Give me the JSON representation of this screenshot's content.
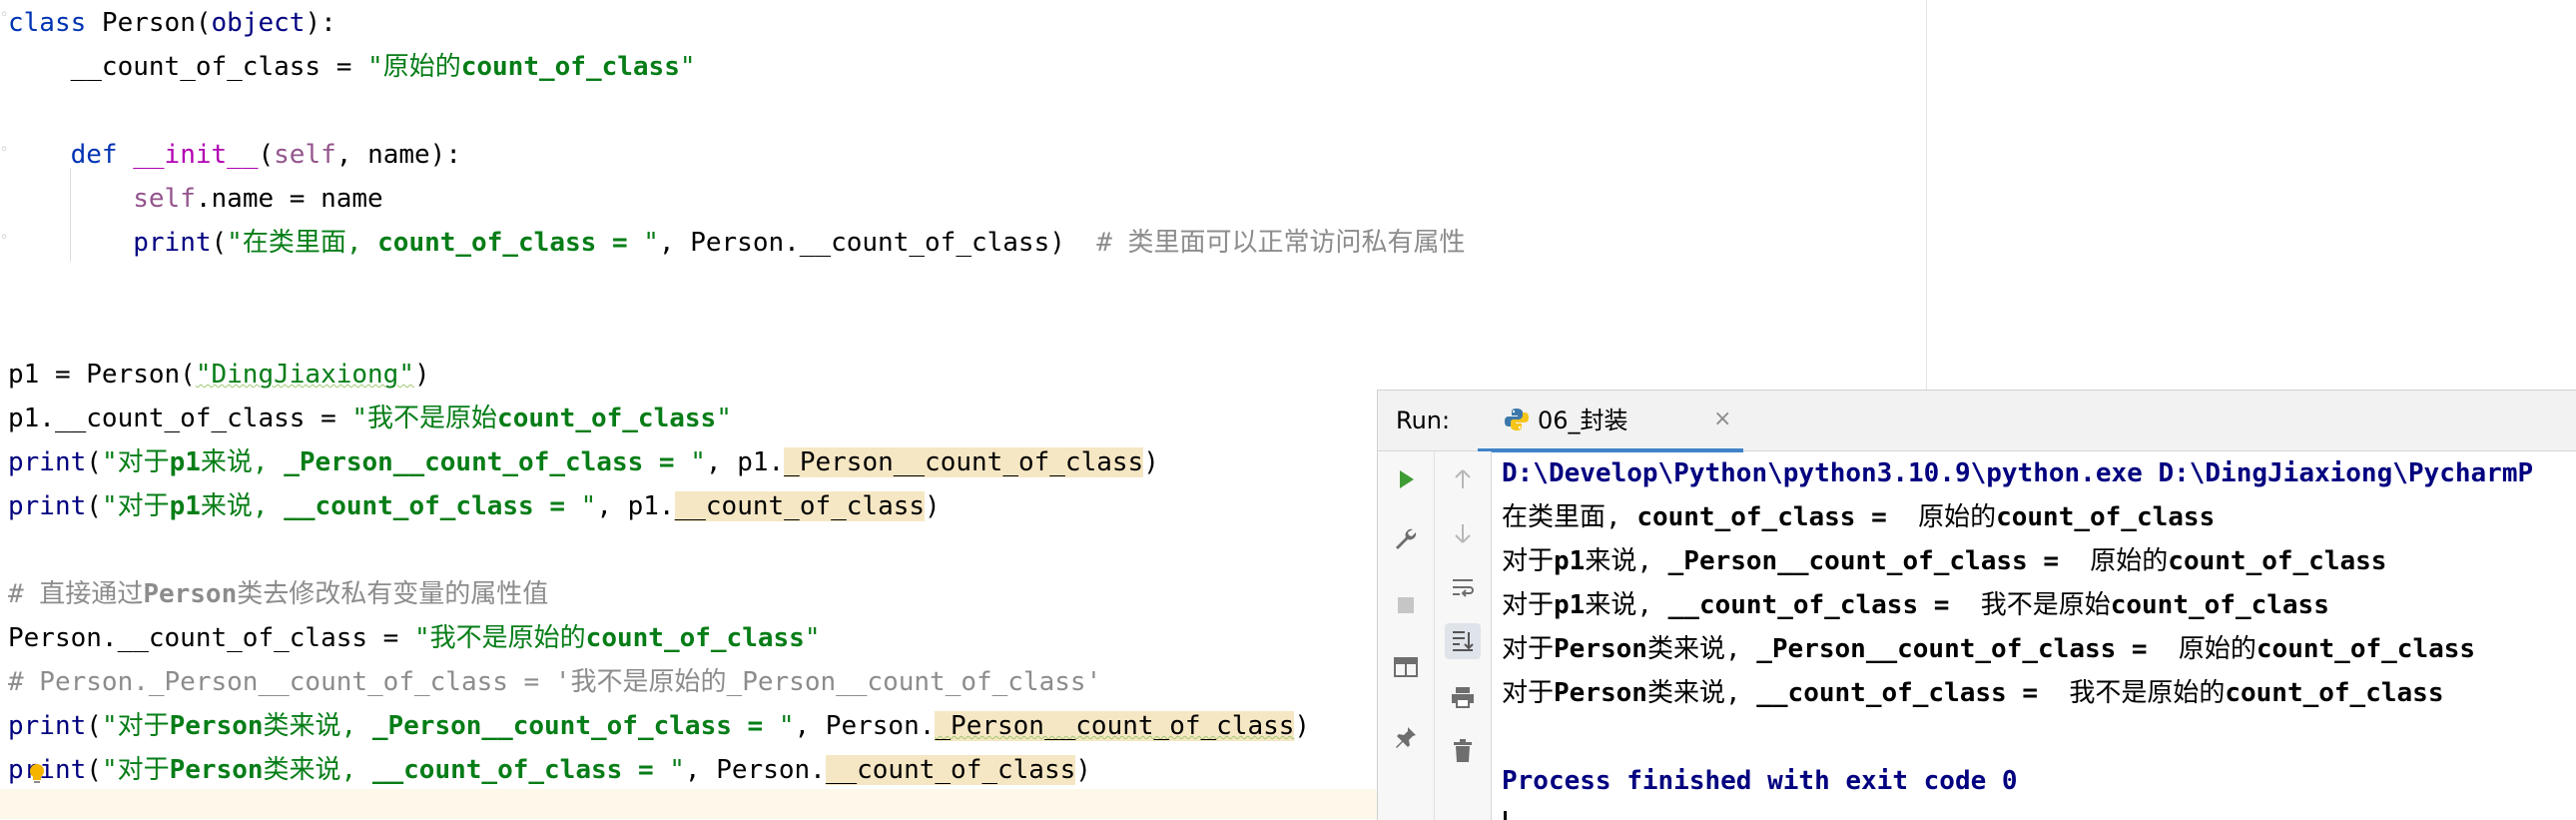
{
  "editor": {
    "lines": {
      "l1": {
        "kw": "class",
        "name": " Person",
        "open": "(",
        "base": "object",
        "close": "):"
      },
      "l2": {
        "indent": "    ",
        "attr": "__count_of_class",
        "eq": " = ",
        "str_open": "\"",
        "str_cn": "原始的",
        "str_en": "count_of_class",
        "str_close": "\""
      },
      "l4": {
        "indent": "    ",
        "kw": "def",
        "sp": " ",
        "fn": "__init__",
        "open": "(",
        "self": "self",
        "rest": ", name):"
      },
      "l5": {
        "indent": "        ",
        "self": "self",
        "rest": ".name = name"
      },
      "l6": {
        "indent": "        ",
        "fn": "print",
        "open": "(",
        "str_open": "\"",
        "str_cn": "在类里面, ",
        "str_en": "count_of_class = ",
        "str_close": "\"",
        "rest": ", Person.__count_of_class)  ",
        "comment": "# 类里面可以正常访问私有属性"
      },
      "l9": {
        "lhs": "p1 = Person(",
        "str": "\"DingJiaxiong\"",
        "close": ")"
      },
      "l10": {
        "lhs": "p1.__count_of_class = ",
        "str_open": "\"",
        "str_cn": "我不是原始",
        "str_en": "count_of_class",
        "str_close": "\""
      },
      "l11": {
        "fn": "print",
        "open": "(",
        "str_open": "\"",
        "str_cn1": "对于",
        "str_en1": "p1",
        "str_cn2": "来说, ",
        "str_en2": "_Person__count_of_class = ",
        "str_close": "\"",
        "mid": ", p1.",
        "hl": "_Person__count_of_class",
        "close": ")"
      },
      "l12": {
        "fn": "print",
        "open": "(",
        "str_open": "\"",
        "str_cn1": "对于",
        "str_en1": "p1",
        "str_cn2": "来说, ",
        "str_en2": "__count_of_class = ",
        "str_close": "\"",
        "mid": ", p1.",
        "hl": "__count_of_class",
        "close": ")"
      },
      "l14": {
        "c1": "# 直接通过",
        "c2": "Person",
        "c3": "类去修改私有变量的属性值"
      },
      "l15": {
        "lhs": "Person.__count_of_class = ",
        "str_open": "\"",
        "str_cn": "我不是原始的",
        "str_en": "count_of_class",
        "str_close": "\""
      },
      "l16": {
        "c1": "# Person._Person__count_of_class = '",
        "c2": "我不是原始的",
        "c3": "_Person__count_of_class'"
      },
      "l17": {
        "fn": "print",
        "open": "(",
        "str_open": "\"",
        "str_cn1": "对于",
        "str_en1": "Person",
        "str_cn2": "类来说, ",
        "str_en2": "_Person__count_of_class = ",
        "str_close": "\"",
        "mid": ", Person.",
        "hl": "_Person__count_of_class",
        "close": ")"
      },
      "l18": {
        "fn_a": "p",
        "fn_b": "rint",
        "open": "(",
        "str_open": "\"",
        "str_cn1": "对于",
        "str_en1": "Person",
        "str_cn2": "类来说, ",
        "str_en2": "__count_of_class = ",
        "str_close": "\"",
        "mid": ", Person.",
        "hl": "__count_of_class",
        "close": ")"
      }
    }
  },
  "run_panel": {
    "label": "Run:",
    "tab_label": "06_封装",
    "tab_close": "×",
    "output": {
      "cmd": "D:\\Develop\\Python\\python3.10.9\\python.exe D:\\DingJiaxiong\\PycharmP",
      "o1": {
        "cn": "在类里面, ",
        "en": "count_of_class = ",
        "cn2": " 原始的",
        "en2": "count_of_class"
      },
      "o2": {
        "cn": "对于",
        "en": "p1",
        "cn2": "来说, ",
        "en2": "_Person__count_of_class = ",
        "cn3": " 原始的",
        "en3": "count_of_class"
      },
      "o3": {
        "cn": "对于",
        "en": "p1",
        "cn2": "来说, ",
        "en2": "__count_of_class = ",
        "cn3": " 我不是原始",
        "en3": "count_of_class"
      },
      "o4": {
        "cn": "对于",
        "en": "Person",
        "cn2": "类来说, ",
        "en2": "_Person__count_of_class = ",
        "cn3": " 原始的",
        "en3": "count_of_class"
      },
      "o5": {
        "cn": "对于",
        "en": "Person",
        "cn2": "类来说, ",
        "en2": "__count_of_class = ",
        "cn3": " 我不是原始的",
        "en3": "count_of_class"
      },
      "finished": "Process finished with exit code 0"
    },
    "toolbar": {
      "rerun": "play-icon",
      "settings": "wrench-icon",
      "stop": "stop-icon",
      "layout": "layout-icon",
      "pin": "pin-icon",
      "up": "arrow-up-icon",
      "down": "arrow-down-icon",
      "wrap": "soft-wrap-icon",
      "scroll": "scroll-to-end-icon",
      "print": "print-icon",
      "trash": "trash-icon"
    }
  },
  "colors": {
    "keyword": "#0033b3",
    "string": "#067d17",
    "comment": "#8c8c8c",
    "magic": "#b200b2",
    "self": "#94558d",
    "highlight": "#f6e7c4",
    "run_green": "#3f9c35",
    "tab_underline": "#4083c9"
  }
}
